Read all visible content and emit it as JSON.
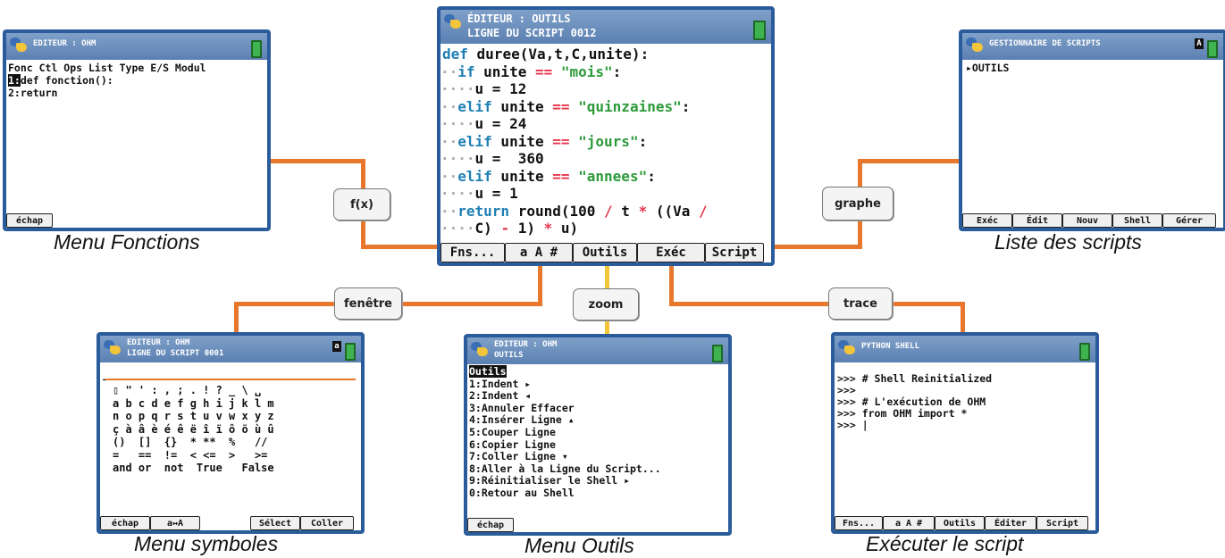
{
  "main": {
    "title1": "ÉDITEUR : OUTILS",
    "title2": "LIGNE DU SCRIPT 0012",
    "code": [
      [
        "def duree(Va,t,C,unite):"
      ],
      [
        "if unite == \"mois\":"
      ],
      [
        "u = 12"
      ],
      [
        "elif unite == \"quinzaines\":"
      ],
      [
        "u = 24"
      ],
      [
        "elif unite == \"jours\":"
      ],
      [
        "u =  360"
      ],
      [
        "elif unite == \"annees\":"
      ],
      [
        "u = 1"
      ],
      [
        "return round(100 / t * ((Va /"
      ],
      [
        "C) - 1) * u)"
      ]
    ],
    "buttons": [
      "Fns...",
      "a A #",
      "Outils",
      "Exéc",
      "Script"
    ]
  },
  "fonctions": {
    "title": "EDITEUR : OHM",
    "menu": "Fonc Ctl Ops List Type E/S Modul",
    "item1": "def fonction():",
    "item1_num": "1:",
    "item2": "2:return",
    "button": "échap",
    "caption": "Menu Fonctions"
  },
  "scripts": {
    "title": "GESTIONNAIRE DE SCRIPTS",
    "item": "▸OUTILS",
    "buttons": [
      "Exéc",
      "Édit",
      "Nouv",
      "Shell",
      "Gérer"
    ],
    "caption": "Liste des scripts"
  },
  "symboles": {
    "title1": "EDITEUR : OHM",
    "title2": "LIGNE DU SCRIPT 0001",
    "rows": [
      "▯ \" ' : , ; . ! ? _ \\ ␣",
      "a b c d e f g h i j k l m",
      "n o p q r s t u v w x y z",
      "",
      "ç à â è é ê ë î ï ô ö ù û",
      "",
      "()  []  {}  * **  %   //",
      "=   ==  !=  < <=  >   >=",
      "and or  not  True   False"
    ],
    "buttons": [
      "échap",
      "a↔A",
      "",
      "Sélect",
      "Coller"
    ],
    "caption": "Menu symboles"
  },
  "outils": {
    "title1": "EDITEUR : OHM",
    "title2": "OUTILS",
    "header": "Outils",
    "items": [
      "1:Indent ▸",
      "2:Indent ◂",
      "3:Annuler Effacer",
      "4:Insérer Ligne ▴",
      "5:Couper Ligne",
      "6:Copier Ligne",
      "7:Coller Ligne ▾",
      "8:Aller à la Ligne du Script...",
      "9:Réinitialiser le Shell ▸",
      "0:Retour au Shell"
    ],
    "button": "échap",
    "caption": "Menu Outils"
  },
  "shell": {
    "title": "PYTHON SHELL",
    "lines": [
      ">>> # Shell Reinitialized",
      ">>>",
      ">>> # L'exécution de OHM",
      ">>> from OHM import *",
      ">>> |"
    ],
    "buttons": [
      "Fns...",
      "a A #",
      "Outils",
      "Éditer",
      "Script"
    ],
    "caption": "Exécuter le script"
  },
  "keys": {
    "fx": "f(x)",
    "graphe": "graphe",
    "fenetre": "fenêtre",
    "zoom": "zoom",
    "trace": "trace"
  }
}
